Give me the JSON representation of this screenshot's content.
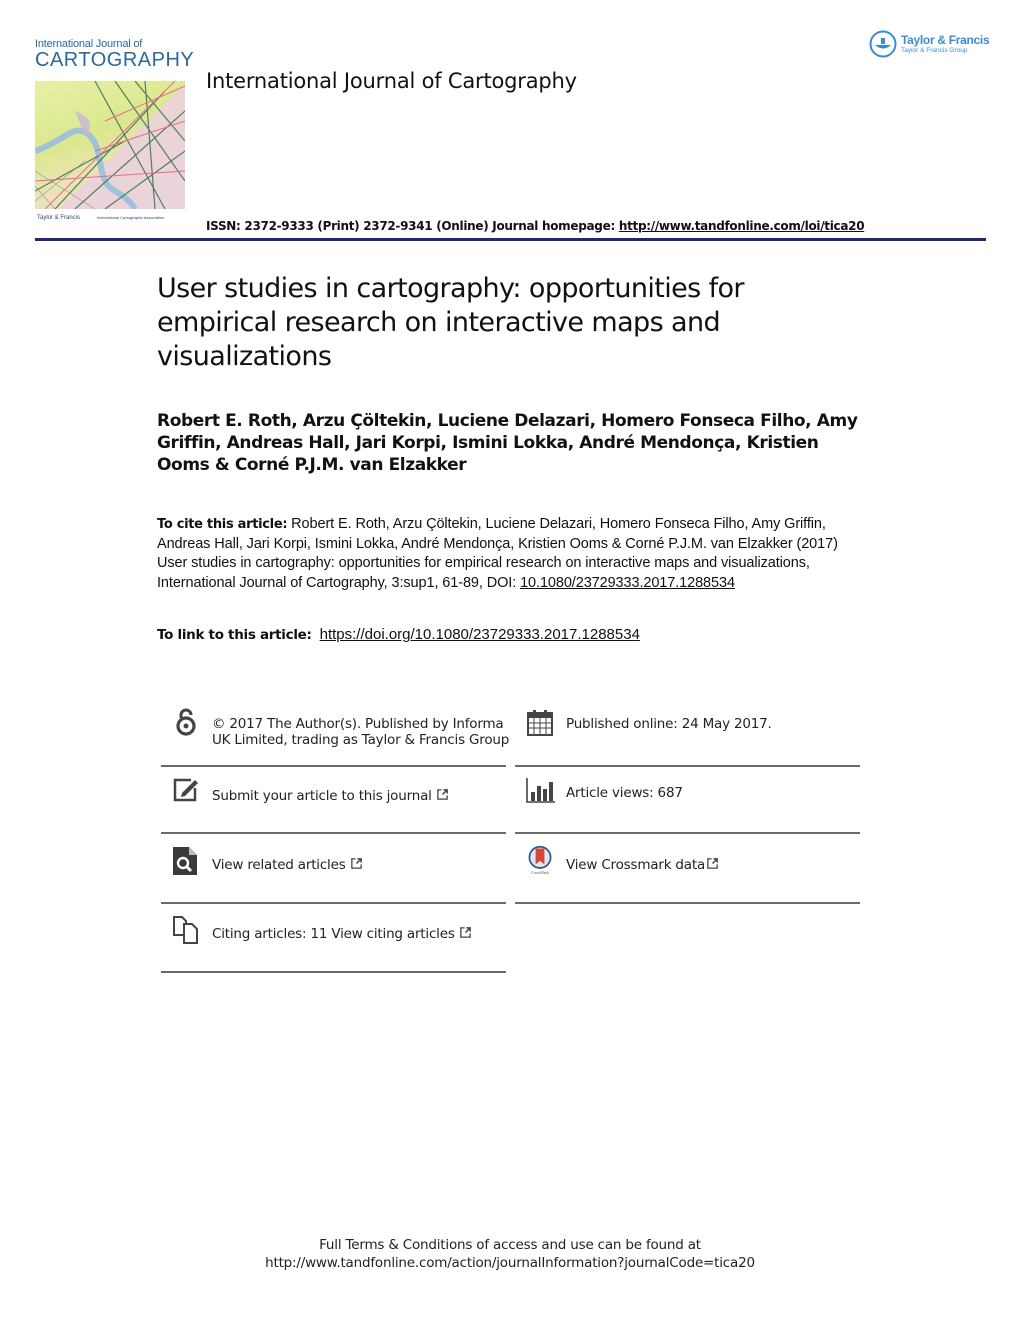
{
  "header": {
    "cover": {
      "title_small": "International Journal of",
      "title_big": "CARTOGRAPHY",
      "publisher_logo_text": "Taylor & Francis",
      "association_logo_text": "International Cartographic Association"
    },
    "journal_name": "International Journal of Cartography",
    "publisher_logo": {
      "brand": "Taylor & Francis",
      "sub": "Taylor & Francis Group"
    },
    "issn_text": "ISSN: 2372-9333 (Print) 2372-9341 (Online) Journal homepage: ",
    "homepage_url": "http://www.tandfonline.com/loi/tica20",
    "accent_color": "#1f2a6e"
  },
  "article": {
    "title": "User studies in cartography: opportunities for empirical research on interactive maps and visualizations",
    "authors": "Robert E. Roth, Arzu Çöltekin, Luciene Delazari, Homero Fonseca Filho, Amy Griffin, Andreas Hall, Jari Korpi, Ismini Lokka, André Mendonça, Kristien Ooms & Corné P.J.M. van Elzakker"
  },
  "citation": {
    "label": "To cite this article:",
    "text": " Robert E. Roth, Arzu Çöltekin, Luciene Delazari, Homero Fonseca Filho, Amy Griffin, Andreas Hall, Jari Korpi, Ismini Lokka, André Mendonça, Kristien Ooms & Corné P.J.M. van Elzakker (2017) User studies in cartography: opportunities for empirical research on interactive maps and visualizations, International Journal of Cartography, 3:sup1, 61-89, DOI: ",
    "doi": "10.1080/23729333.2017.1288534",
    "link_label": "To link to this article:",
    "link_url": "https://doi.org/10.1080/23729333.2017.1288534"
  },
  "info": {
    "license": {
      "icon": "open-access-icon",
      "text": "© 2017 The Author(s). Published by Informa UK Limited, trading as Taylor & Francis Group"
    },
    "published": {
      "icon": "calendar-icon",
      "text": "Published online: 24 May 2017."
    },
    "submit": {
      "icon": "edit-icon",
      "text": "Submit your article to this journal"
    },
    "views": {
      "icon": "bar-chart-icon",
      "text": "Article views: 687"
    },
    "related": {
      "icon": "document-search-icon",
      "text": "View related articles"
    },
    "crossmark": {
      "icon": "crossmark-icon",
      "text": "View Crossmark data"
    },
    "citing": {
      "icon": "copy-documents-icon",
      "text": "Citing articles: 11 View citing articles"
    }
  },
  "footer": {
    "line1": "Full Terms & Conditions of access and use can be found at",
    "line2": "http://www.tandfonline.com/action/journalInformation?journalCode=tica20"
  }
}
